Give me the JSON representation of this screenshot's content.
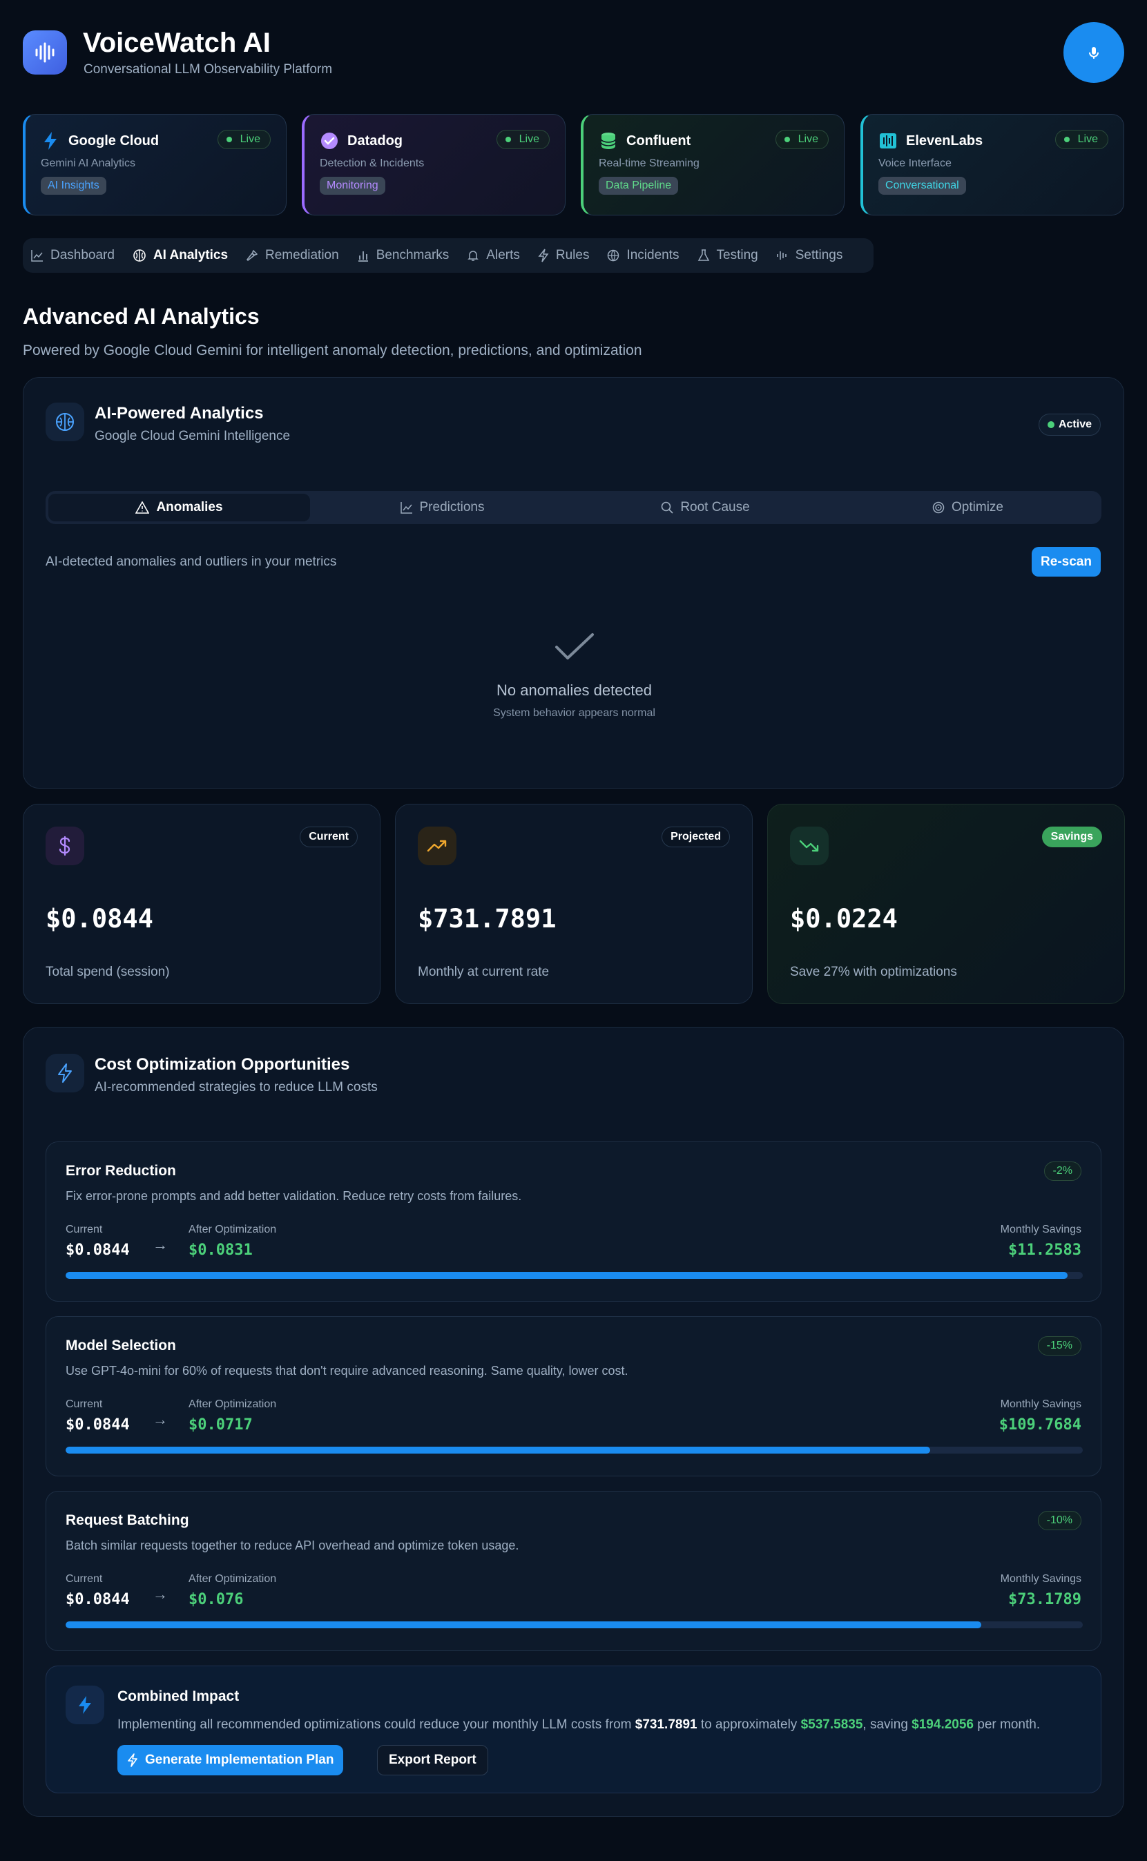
{
  "app": {
    "title": "VoiceWatch AI",
    "subtitle": "Conversational LLM Observability Platform"
  },
  "integrations": [
    {
      "name": "Google Cloud",
      "status": "Live",
      "description": "Gemini AI Analytics",
      "tag": "AI Insights",
      "accent": "#1a8cf0",
      "tag_color": "#4aa3ff"
    },
    {
      "name": "Datadog",
      "status": "Live",
      "description": "Detection & Incidents",
      "tag": "Monitoring",
      "accent": "#9b6bff",
      "tag_color": "#b48bff"
    },
    {
      "name": "Confluent",
      "status": "Live",
      "description": "Real-time Streaming",
      "tag": "Data Pipeline",
      "accent": "#4cd07a",
      "tag_color": "#5fd98a"
    },
    {
      "name": "ElevenLabs",
      "status": "Live",
      "description": "Voice Interface",
      "tag": "Conversational",
      "accent": "#22c1d6",
      "tag_color": "#3fd6e6"
    }
  ],
  "nav": [
    {
      "label": "Dashboard",
      "icon": "chart-line-icon",
      "active": false
    },
    {
      "label": "AI Analytics",
      "icon": "brain-icon",
      "active": true
    },
    {
      "label": "Remediation",
      "icon": "wrench-icon",
      "active": false
    },
    {
      "label": "Benchmarks",
      "icon": "bar-chart-icon",
      "active": false
    },
    {
      "label": "Alerts",
      "icon": "bell-icon",
      "active": false
    },
    {
      "label": "Rules",
      "icon": "bolt-icon",
      "active": false
    },
    {
      "label": "Incidents",
      "icon": "globe-icon",
      "active": false
    },
    {
      "label": "Testing",
      "icon": "flask-icon",
      "active": false
    },
    {
      "label": "Settings",
      "icon": "waveform-icon",
      "active": false
    }
  ],
  "page": {
    "title": "Advanced AI Analytics",
    "subtitle": "Powered by Google Cloud Gemini for intelligent anomaly detection, predictions, and optimization"
  },
  "ai_panel": {
    "title": "AI-Powered Analytics",
    "subtitle": "Google Cloud Gemini Intelligence",
    "status": "Active",
    "tabs": [
      {
        "label": "Anomalies",
        "icon": "warning-icon",
        "active": true
      },
      {
        "label": "Predictions",
        "icon": "chart-line-icon",
        "active": false
      },
      {
        "label": "Root Cause",
        "icon": "search-icon",
        "active": false
      },
      {
        "label": "Optimize",
        "icon": "target-icon",
        "active": false
      }
    ],
    "description": "AI-detected anomalies and outliers in your metrics",
    "rescan_label": "Re-scan",
    "empty_title": "No anomalies detected",
    "empty_subtitle": "System behavior appears normal"
  },
  "cost_cards": [
    {
      "badge": "Current",
      "value": "$0.0844",
      "label": "Total spend (session)",
      "icon": "dollar-icon"
    },
    {
      "badge": "Projected",
      "value": "$731.7891",
      "label": "Monthly at current rate",
      "icon": "trending-up-icon"
    },
    {
      "badge": "Savings",
      "value": "$0.0224",
      "label": "Save 27% with optimizations",
      "icon": "trending-down-icon"
    }
  ],
  "optimization": {
    "title": "Cost Optimization Opportunities",
    "subtitle": "AI-recommended strategies to reduce LLM costs",
    "labels": {
      "current": "Current",
      "after": "After Optimization",
      "savings": "Monthly Savings"
    },
    "strategies": [
      {
        "title": "Error Reduction",
        "description": "Fix error-prone prompts and add better validation. Reduce retry costs from failures.",
        "percent": "-2%",
        "current": "$0.0844",
        "after": "$0.0831",
        "savings": "$11.2583",
        "progress": 0.985
      },
      {
        "title": "Model Selection",
        "description": "Use GPT-4o-mini for 60% of requests that don't require advanced reasoning. Same quality, lower cost.",
        "percent": "-15%",
        "current": "$0.0844",
        "after": "$0.0717",
        "savings": "$109.7684",
        "progress": 0.85
      },
      {
        "title": "Request Batching",
        "description": "Batch similar requests together to reduce API overhead and optimize token usage.",
        "percent": "-10%",
        "current": "$0.0844",
        "after": "$0.076",
        "savings": "$73.1789",
        "progress": 0.9
      }
    ],
    "combined": {
      "title": "Combined Impact",
      "text_1": "Implementing all recommended optimizations could reduce your monthly LLM costs from ",
      "from": "$731.7891",
      "text_2": " to approximately ",
      "to": "$537.5835",
      "text_3": ", saving ",
      "saving": "$194.2056",
      "text_4": " per month.",
      "primary_label": "Generate Implementation Plan",
      "secondary_label": "Export Report"
    }
  }
}
